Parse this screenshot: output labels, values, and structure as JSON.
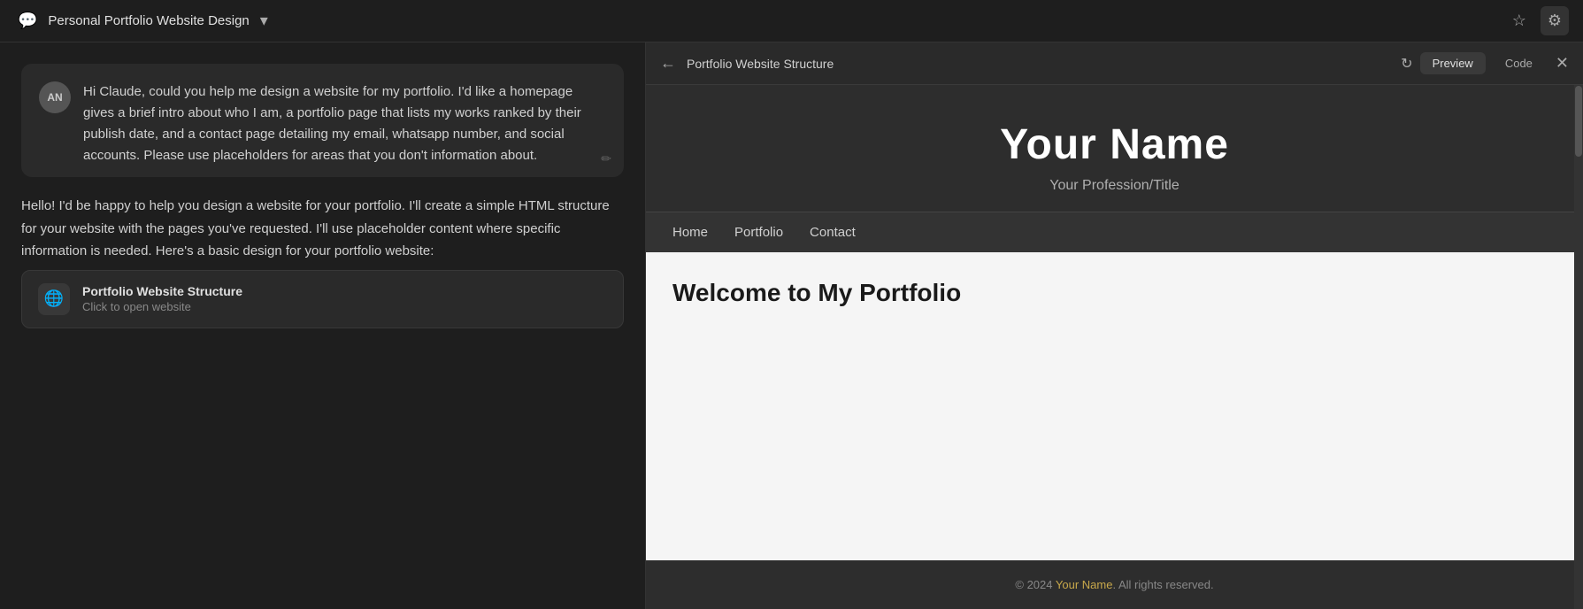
{
  "topbar": {
    "chat_icon": "💬",
    "title": "Personal Portfolio Website Design",
    "chevron": "▾",
    "star_icon": "☆",
    "settings_icon": "⚙"
  },
  "chat": {
    "user_avatar": "AN",
    "user_message": "Hi Claude, could you help me design a website for my portfolio. I'd like a homepage gives a brief intro about who I am, a portfolio page that lists my works ranked by their publish date, and a contact page detailing my email, whatsapp number, and social accounts. Please use placeholders for areas that you don't information about.",
    "ai_intro": "Hello! I'd be happy to help you design a website for your portfolio. I'll create a simple HTML structure for your website with the pages you've requested. I'll use placeholder content where specific information is needed. Here's a basic design for your portfolio website:",
    "artifact": {
      "icon": "🌐",
      "title": "Portfolio Website Structure",
      "subtitle": "Click to open website"
    }
  },
  "preview": {
    "back_icon": "←",
    "title": "Portfolio Website Structure",
    "refresh_icon": "↻",
    "tab_preview": "Preview",
    "tab_code": "Code",
    "close_icon": "✕",
    "site": {
      "name": "Your Name",
      "profession": "Your Profession/Title",
      "nav_items": [
        "Home",
        "Portfolio",
        "Contact"
      ],
      "welcome_heading": "Welcome to My Portfolio",
      "footer_text": "© 2024 ",
      "footer_name": "Your Name",
      "footer_suffix": ". All rights reserved."
    }
  }
}
